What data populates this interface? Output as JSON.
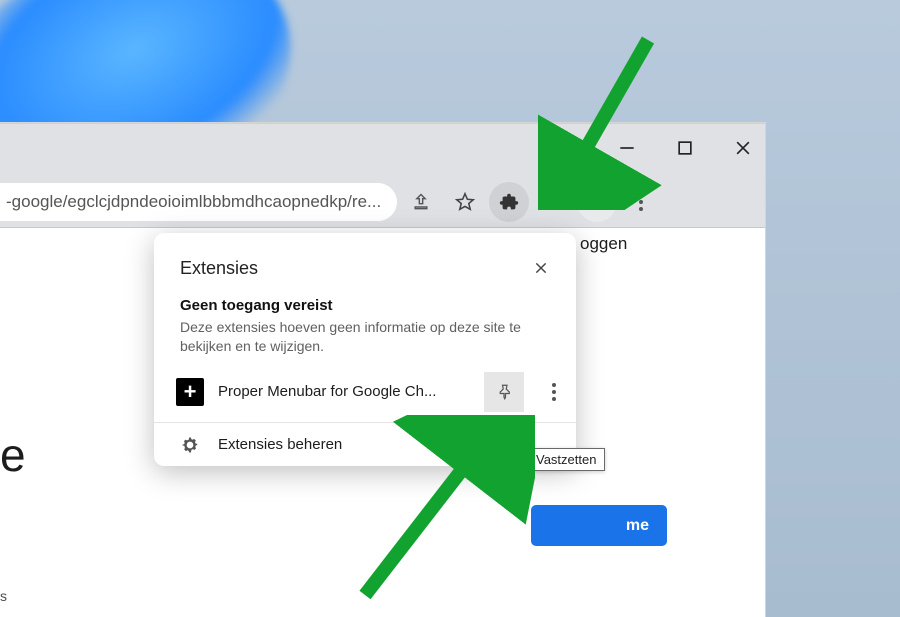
{
  "toolbar": {
    "url_fragment": "-google/egclcjdpndeoioimlbbbmdhcaopnedkp/re..."
  },
  "popup": {
    "title": "Extensies",
    "no_access_title": "Geen toegang vereist",
    "no_access_desc": "Deze extensies hoeven geen informatie op deze site te bekijken en te wijzigen.",
    "extension": {
      "name": "Proper Menubar for Google Ch...",
      "icon_label": "+"
    },
    "manage_label": "Extensies beheren"
  },
  "tooltip": {
    "pin_label": "Vastzetten"
  },
  "content": {
    "login_text": "oggen",
    "left_e": "e",
    "left_s": "s",
    "button_suffix": "me"
  },
  "arrow_color": "#12a22f"
}
